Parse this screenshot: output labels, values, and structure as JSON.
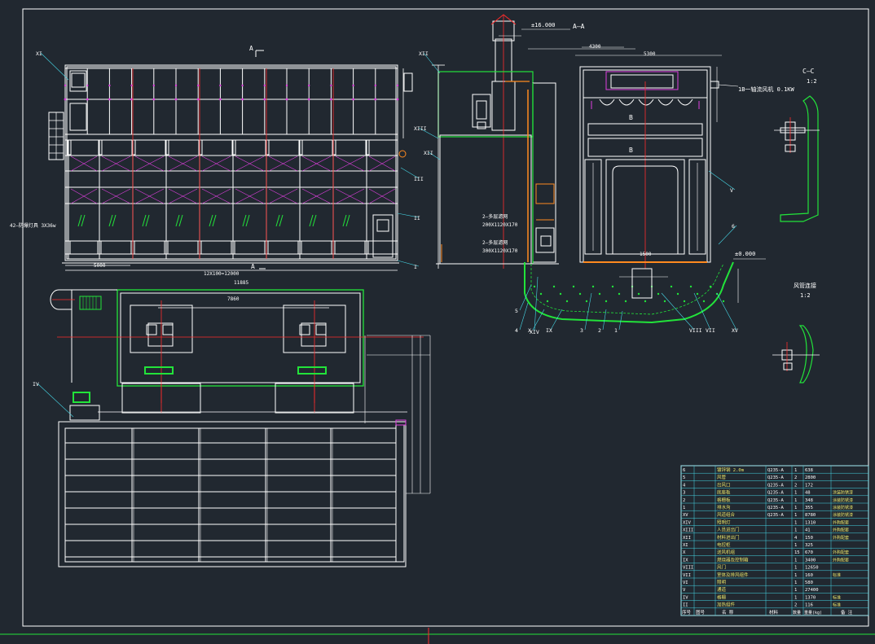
{
  "colors": {
    "background": "#212830",
    "line": "#ffffff",
    "red": "#ff2b2b",
    "green": "#22e33a",
    "magenta": "#e040e0",
    "orange": "#ff8a1f",
    "cyan": "#46d7e6",
    "yellow": "#e9e36a",
    "gray": "#9aa4ae"
  },
  "labels": {
    "section_a_top": "A",
    "section_a_bottom": "A",
    "section_aa": "A—A",
    "section_bb_top": "B",
    "section_bb_bottom": "B",
    "section_cc": "C—C",
    "scale_cc": "1:2",
    "detail_title": "风管连接",
    "scale_detail": "1:2",
    "elev_top": "±16.000",
    "elev_floor": "±0.000",
    "fan_note": "1B一轴流风机 0.1KW",
    "filter_note_1": "2—多层滤网",
    "filter_size_1": "200X1120X170",
    "filter_note_2": "2—多层滤网",
    "filter_size_2": "300X1120X170",
    "lamp_note": "42—防爆灯具 3X36w",
    "dim_11885": "11885",
    "dim_5000": "5000",
    "dim_7860": "7860",
    "dim_4300": "4300",
    "dim_5300": "5300",
    "dim_12x": "12X100=12000",
    "dim_1500": "1500"
  },
  "callouts": [
    "XI",
    "IV",
    "XII",
    "XIII",
    "III",
    "II",
    "I",
    "XII",
    "XIV",
    "V",
    "6",
    "5",
    "4",
    "X",
    "IX",
    "3",
    "2",
    "1",
    "VIII",
    "VII",
    "XV"
  ],
  "parts_table": {
    "rows": [
      {
        "no": "6",
        "name": "镀锌钢 2.0m",
        "spec": "Q235-A",
        "qty": "1",
        "wt": "638",
        "note": ""
      },
      {
        "no": "5",
        "name": "风管",
        "spec": "Q235-A",
        "qty": "2",
        "wt": "2800",
        "note": ""
      },
      {
        "no": "4",
        "name": "出风口",
        "spec": "Q235-A",
        "qty": "2",
        "wt": "172",
        "note": ""
      },
      {
        "no": "3",
        "name": "底座板",
        "spec": "Q235-A",
        "qty": "1",
        "wt": "48",
        "note": "涂装防锈漆"
      },
      {
        "no": "2",
        "name": "格栅板",
        "spec": "Q235-A",
        "qty": "1",
        "wt": "348",
        "note": "涂装防锈漆"
      },
      {
        "no": "1",
        "name": "排水沟",
        "spec": "Q235-A",
        "qty": "1",
        "wt": "355",
        "note": "涂装防锈漆"
      },
      {
        "no": "XV",
        "name": "风道组合",
        "spec": "Q235-A",
        "qty": "1",
        "wt": "8780",
        "note": "涂装防锈漆"
      },
      {
        "no": "XIV",
        "name": "照明灯",
        "spec": "",
        "qty": "1",
        "wt": "1310",
        "note": "外购配套"
      },
      {
        "no": "XIII",
        "name": "人员进出门",
        "spec": "",
        "qty": "1",
        "wt": "41",
        "note": "外购配套"
      },
      {
        "no": "XII",
        "name": "材料进出门",
        "spec": "",
        "qty": "4",
        "wt": "150",
        "note": "外购配套"
      },
      {
        "no": "XI",
        "name": "电控柜",
        "spec": "",
        "qty": "1",
        "wt": "325",
        "note": ""
      },
      {
        "no": "X",
        "name": "送风机组",
        "spec": "",
        "qty": "15",
        "wt": "670",
        "note": "外购配套"
      },
      {
        "no": "IX",
        "name": "燃烧器及控制箱",
        "spec": "",
        "qty": "1",
        "wt": "3400",
        "note": "外购配套"
      },
      {
        "no": "VIII",
        "name": "风门",
        "spec": "",
        "qty": "1",
        "wt": "12650",
        "note": ""
      },
      {
        "no": "VII",
        "name": "室体及排风组件",
        "spec": "",
        "qty": "1",
        "wt": "160",
        "note": "标准"
      },
      {
        "no": "VI",
        "name": "照明",
        "spec": "",
        "qty": "1",
        "wt": "580",
        "note": ""
      },
      {
        "no": "V",
        "name": "通道",
        "spec": "",
        "qty": "1",
        "wt": "27400",
        "note": ""
      },
      {
        "no": "IV",
        "name": "格栅",
        "spec": "",
        "qty": "1",
        "wt": "1370",
        "note": "标准"
      },
      {
        "no": "II",
        "name": "加热组件",
        "spec": "",
        "qty": "2",
        "wt": "116",
        "note": "标准"
      }
    ],
    "header": {
      "no": "序号",
      "code": "图号",
      "name": "名 称",
      "spec": "材料",
      "qty": "数量",
      "wt": "重量(kg)",
      "note": "备 注"
    }
  }
}
